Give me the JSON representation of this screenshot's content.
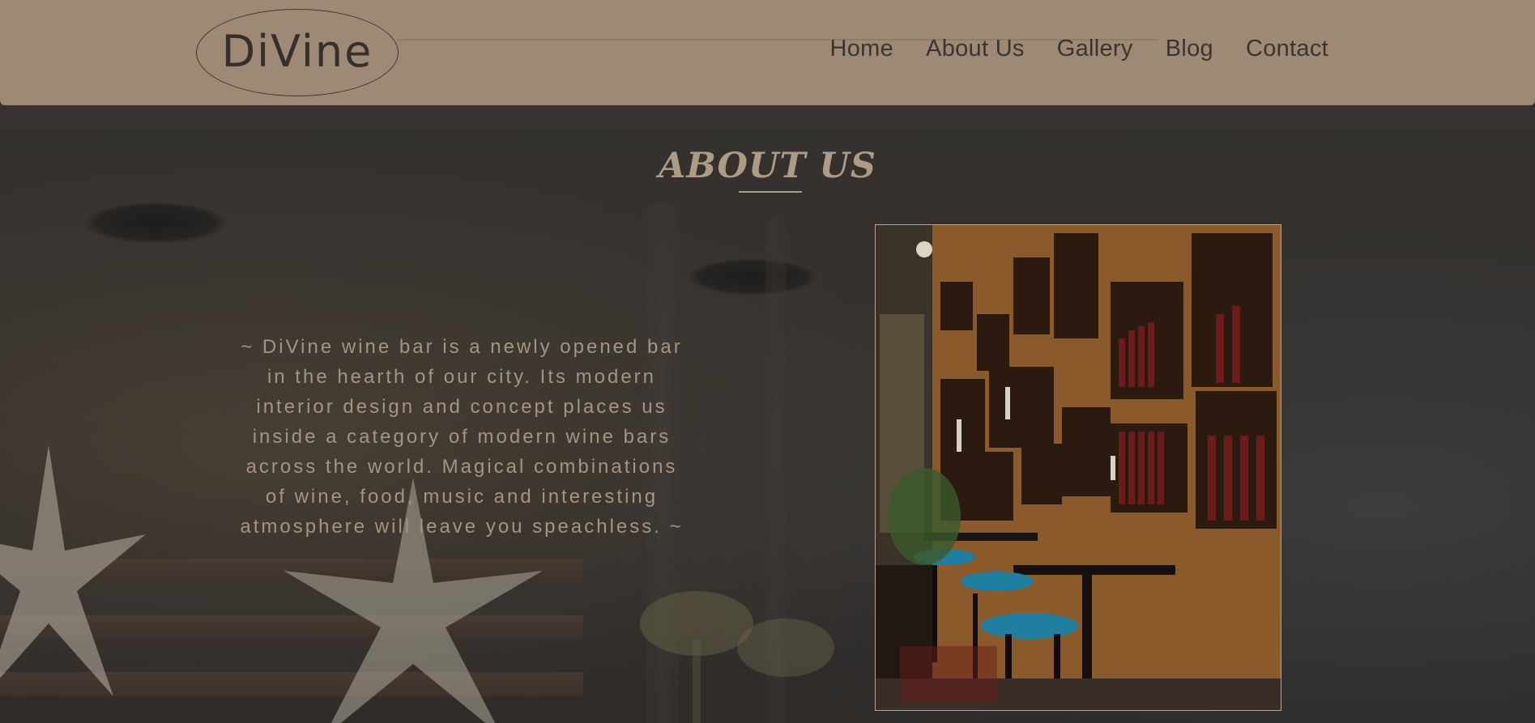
{
  "header": {
    "logo_text": "DiVine",
    "nav": [
      {
        "label": "Home"
      },
      {
        "label": "About Us"
      },
      {
        "label": "Gallery"
      },
      {
        "label": "Blog"
      },
      {
        "label": "Contact"
      }
    ]
  },
  "main": {
    "title": "ABOUT US",
    "description": "~ DiVine wine bar is a newly opened bar in the hearth of our city. Its modern interior design and concept places us inside a category of modern wine bars across the world. Magical combinations of wine, food, music and interesting atmosphere will leave you speachless. ~"
  },
  "colors": {
    "header_bg": "#9e8a74",
    "page_bg": "#2b2927",
    "accent_text": "#ae9b86",
    "nav_text": "#3a3530"
  }
}
